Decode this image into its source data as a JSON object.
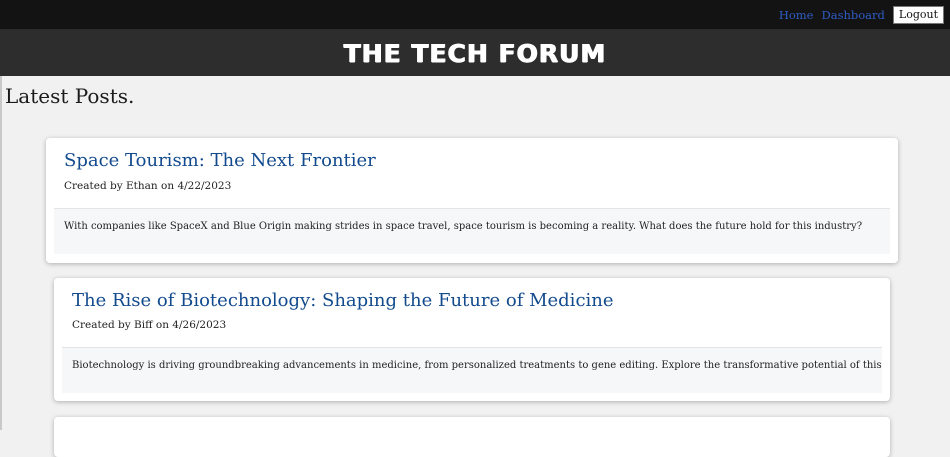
{
  "nav": {
    "home_label": "Home",
    "dashboard_label": "Dashboard",
    "logout_label": "Logout"
  },
  "site": {
    "title": "THE TECH FORUM"
  },
  "feed": {
    "heading": "Latest Posts.",
    "posts": [
      {
        "title": "Space Tourism: The Next Frontier",
        "meta": "Created by Ethan on 4/22/2023",
        "body": "With companies like SpaceX and Blue Origin making strides in space travel, space tourism is becoming a reality. What does the future hold for this industry?"
      },
      {
        "title": "The Rise of Biotechnology: Shaping the Future of Medicine",
        "meta": "Created by Biff on 4/26/2023",
        "body": "Biotechnology is driving groundbreaking advancements in medicine, from personalized treatments to gene editing. Explore the transformative potential of this field."
      }
    ]
  },
  "colors": {
    "topnav_bg": "#131313",
    "header_bg": "#2d2d2d",
    "link": "#2f5cc5",
    "post_title": "#124a8e",
    "page_bg": "#f0f1f0"
  }
}
